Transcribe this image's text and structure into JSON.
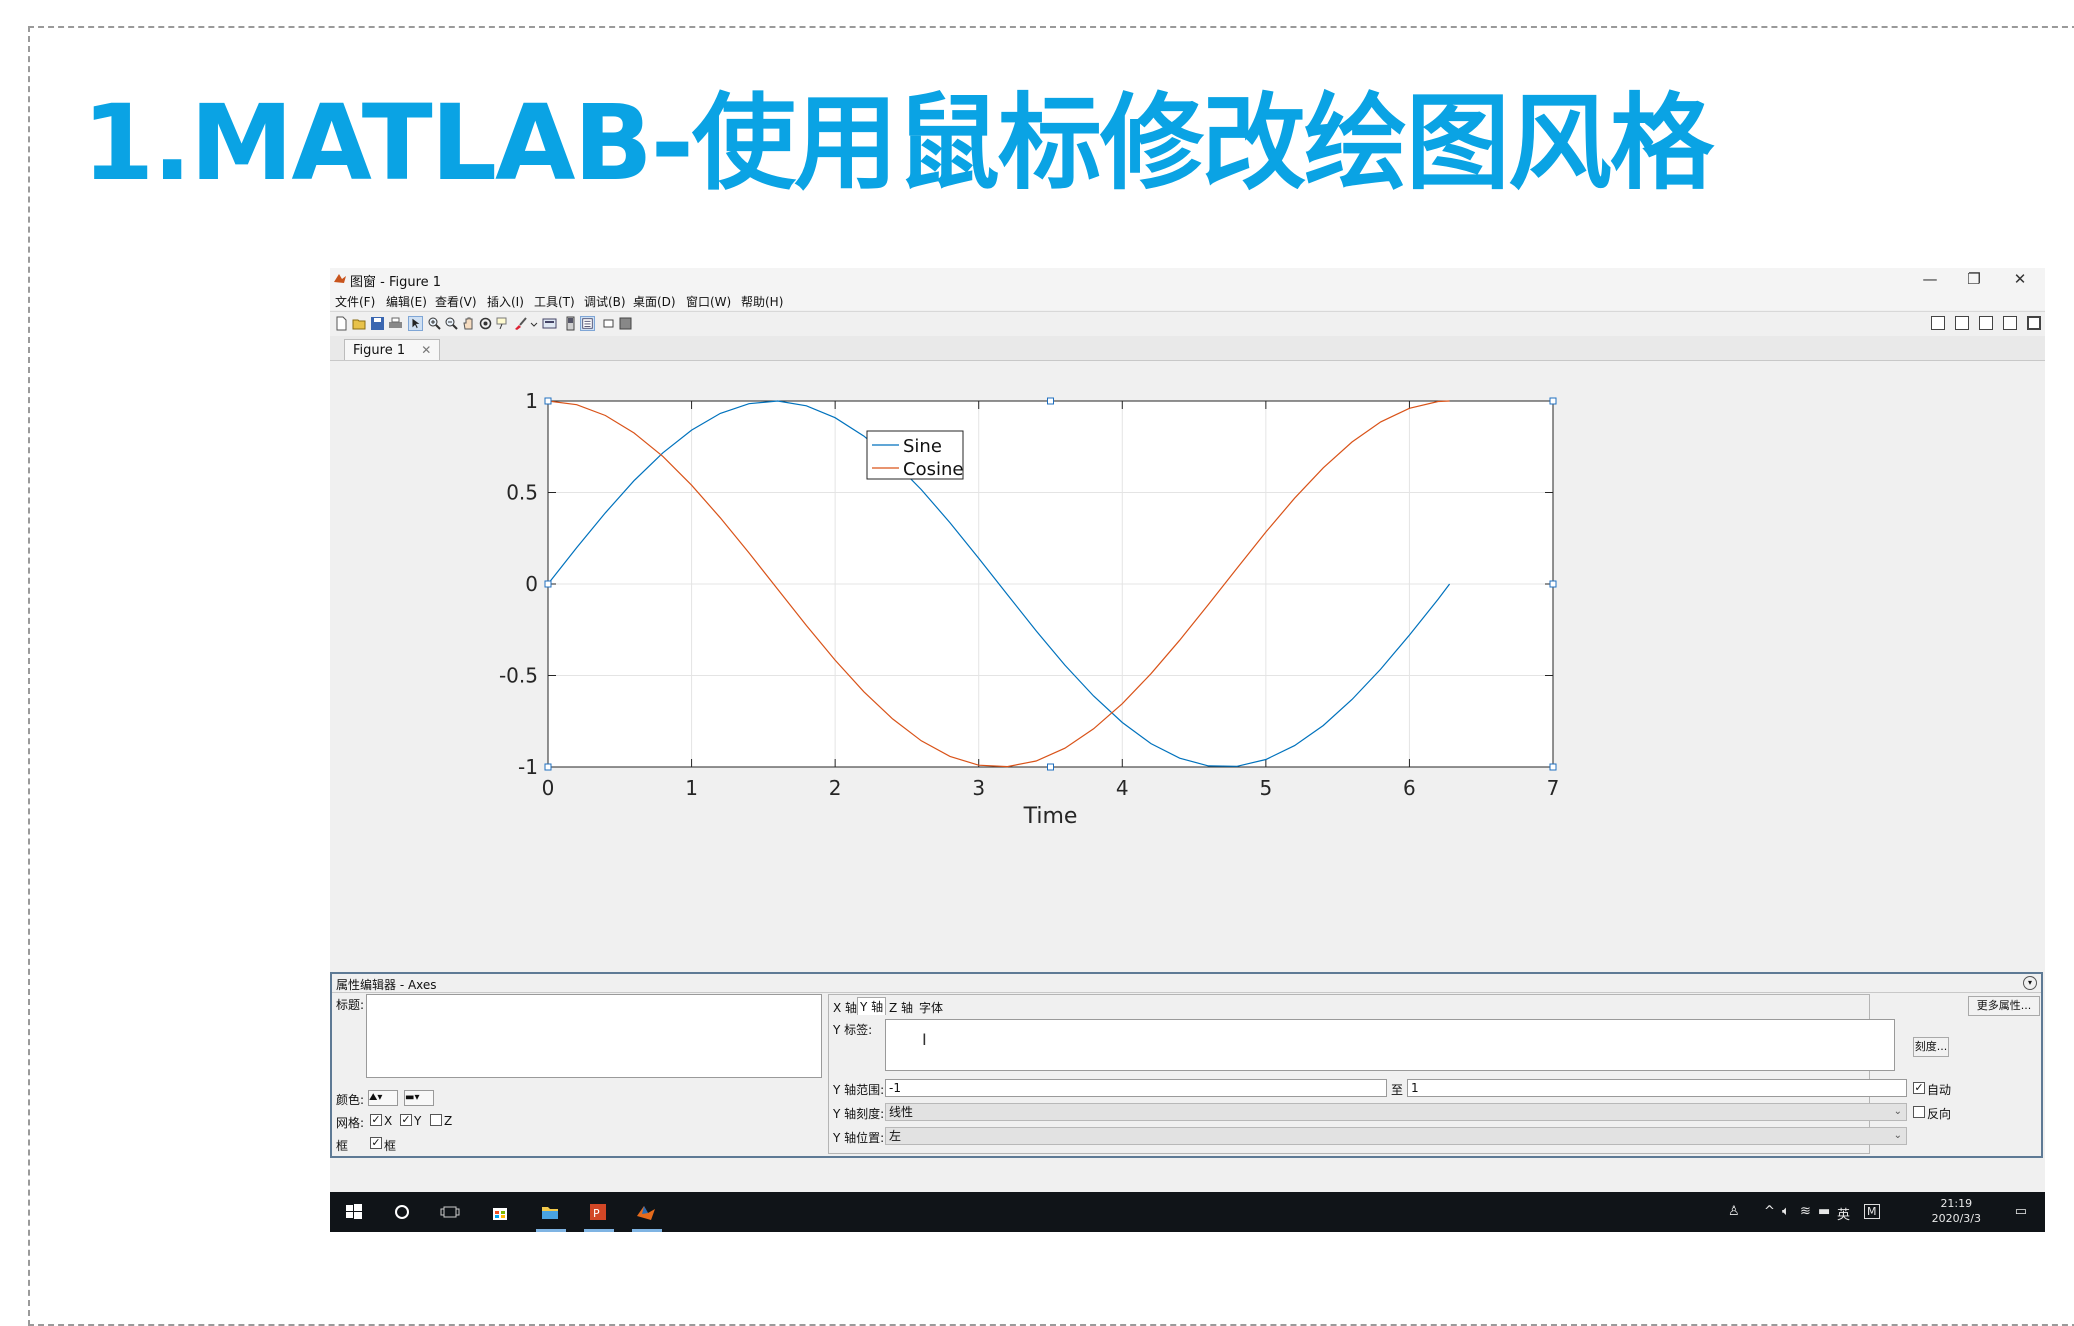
{
  "slide": {
    "title": "1.MATLAB-使用鼠标修改绘图风格"
  },
  "window": {
    "title": "图窗 - Figure 1",
    "controls": {
      "minimize": "—",
      "restore": "❐",
      "close": "✕"
    },
    "dock_controls": "↘ ↗ ✕",
    "menus": [
      "文件(F)",
      "编辑(E)",
      "查看(V)",
      "插入(I)",
      "工具(T)",
      "调试(B)",
      "桌面(D)",
      "窗口(W)",
      "帮助(H)"
    ],
    "toolbar_icons": [
      "new-figure-icon",
      "open-file-icon",
      "save-icon",
      "print-icon",
      "select-arrow-icon",
      "zoom-in-icon",
      "zoom-out-icon",
      "pan-hand-icon",
      "rotate-3d-icon",
      "data-cursor-icon",
      "brush-icon",
      "link-plot-icon",
      "colorbar-icon",
      "legend-icon",
      "hide-plot-tools-icon",
      "show-plot-tools-icon"
    ],
    "tab_label": "Figure 1",
    "tab_close": "✕"
  },
  "chart_data": {
    "type": "line",
    "title": "",
    "xlabel": "Time",
    "ylabel": "",
    "xlim": [
      0,
      7
    ],
    "ylim": [
      -1,
      1
    ],
    "xticks": [
      "0",
      "1",
      "2",
      "3",
      "4",
      "5",
      "6",
      "7"
    ],
    "yticks": [
      "-1",
      "-0.5",
      "0",
      "0.5",
      "1"
    ],
    "xtick_values": [
      0,
      1,
      2,
      3,
      4,
      5,
      6,
      7
    ],
    "ytick_values": [
      -1,
      -0.5,
      0,
      0.5,
      1
    ],
    "grid": true,
    "legend_position": "top-center",
    "x": [
      0,
      0.2,
      0.4,
      0.6,
      0.8,
      1.0,
      1.2,
      1.4,
      1.6,
      1.8,
      2.0,
      2.2,
      2.4,
      2.6,
      2.8,
      3.0,
      3.2,
      3.4,
      3.6,
      3.8,
      4.0,
      4.2,
      4.4,
      4.6,
      4.8,
      5.0,
      5.2,
      5.4,
      5.6,
      5.8,
      6.0,
      6.2,
      6.28
    ],
    "series": [
      {
        "name": "Sine",
        "color": "#0072BD",
        "values": [
          0,
          0.199,
          0.389,
          0.565,
          0.717,
          0.841,
          0.932,
          0.985,
          1.0,
          0.974,
          0.909,
          0.808,
          0.675,
          0.516,
          0.335,
          0.141,
          -0.058,
          -0.256,
          -0.443,
          -0.612,
          -0.757,
          -0.872,
          -0.952,
          -0.994,
          -0.996,
          -0.959,
          -0.883,
          -0.773,
          -0.631,
          -0.465,
          -0.279,
          -0.083,
          0
        ]
      },
      {
        "name": "Cosine",
        "color": "#D95319",
        "values": [
          1,
          0.98,
          0.921,
          0.825,
          0.697,
          0.54,
          0.362,
          0.17,
          -0.029,
          -0.227,
          -0.416,
          -0.589,
          -0.737,
          -0.857,
          -0.942,
          -0.99,
          -0.998,
          -0.967,
          -0.897,
          -0.791,
          -0.654,
          -0.49,
          -0.307,
          -0.112,
          0.087,
          0.284,
          0.469,
          0.635,
          0.776,
          0.886,
          0.96,
          0.997,
          1.0
        ]
      }
    ]
  },
  "property_editor": {
    "header": "属性编辑器 - Axes",
    "title_label": "标题:",
    "color_label": "颜色:",
    "grid_label": "网格:",
    "grid_x": "X",
    "grid_y": "Y",
    "grid_z": "Z",
    "box_label": "框",
    "box_checkbox_label": "框",
    "tabs": [
      "X 轴",
      "Y 轴",
      "Z 轴",
      "字体"
    ],
    "active_tab": "Y 轴",
    "y_label_label": "Y 标签:",
    "ticks_button": "刻度...",
    "more_props_button": "更多属性...",
    "y_range_label": "Y 轴范围:",
    "y_range_min": "-1",
    "y_range_to": "至",
    "y_range_max": "1",
    "auto_label": "自动",
    "y_scale_label": "Y 轴刻度:",
    "y_scale_value": "线性",
    "reverse_label": "反向",
    "y_location_label": "Y 轴位置:",
    "y_location_value": "左",
    "text_cursor": "I"
  },
  "taskbar": {
    "apps": [
      "windows-start-icon",
      "cortana-icon",
      "task-view-icon",
      "store-icon",
      "file-explorer-icon",
      "powerpoint-icon",
      "matlab-icon"
    ],
    "ime": "英",
    "time": "21:19",
    "date": "2020/3/3"
  }
}
